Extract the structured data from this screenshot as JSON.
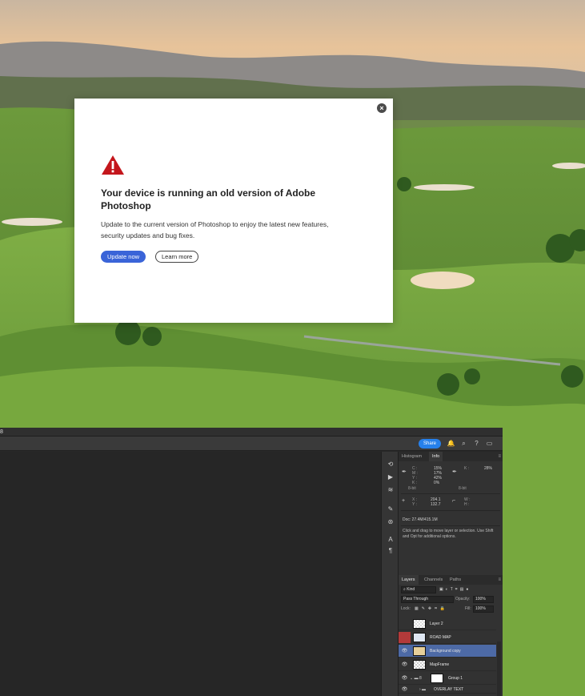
{
  "dialog": {
    "title": "Your device is running an old version of Adobe Photoshop",
    "body": "Update to the current version of Photoshop to enjoy the latest new features, security updates and bug fixes.",
    "primary_button": "Update now",
    "secondary_button": "Learn more",
    "close_icon": "close-icon",
    "warning_icon": "warning-triangle-icon",
    "accent": "#3a64d8",
    "warning_color": "#c4161c"
  },
  "photoshop": {
    "menubar_text": "8",
    "share_label": "Share",
    "toolbar_icons": [
      "bell-icon",
      "search-icon",
      "help-icon",
      "workspace-icon"
    ],
    "info_panel": {
      "tabs": [
        "Histogram",
        "Info"
      ],
      "active_tab": "Info",
      "cmyk": {
        "c_label": "C :",
        "c": "15%",
        "m_label": "M :",
        "m": "17%",
        "y_label": "Y :",
        "y": "42%",
        "k_label": "K :",
        "k": "0%",
        "bit": "8-bit"
      },
      "k2_label": "K :",
      "k2": "28%",
      "bit2": "8-bit",
      "xy": {
        "x_label": "X :",
        "x": "204.1",
        "y_label": "Y :",
        "y": "132.7"
      },
      "wh": {
        "w_label": "W :",
        "h_label": "H :"
      },
      "doc": "Doc: 27.4M/415.1M",
      "hint": "Click and drag to move layer or selection.  Use Shift and Opt for additional options."
    },
    "layers_panel": {
      "tabs": [
        "Layers",
        "Channels",
        "Paths"
      ],
      "active_tab": "Layers",
      "kind_label": "Kind",
      "blend_mode": "Pass Through",
      "opacity_label": "Opacity:",
      "opacity": "100%",
      "lock_label": "Lock:",
      "fill_label": "Fill:",
      "fill": "100%",
      "layers": [
        {
          "name": "Layer 2",
          "visible": false
        },
        {
          "name": "ROAD MAP",
          "visible": false
        },
        {
          "name": "Background copy",
          "visible": true
        },
        {
          "name": "MapFrame",
          "visible": true
        },
        {
          "name": "Group 1",
          "visible": true
        },
        {
          "name": "OVERLAY TEXT",
          "visible": true
        }
      ]
    }
  }
}
